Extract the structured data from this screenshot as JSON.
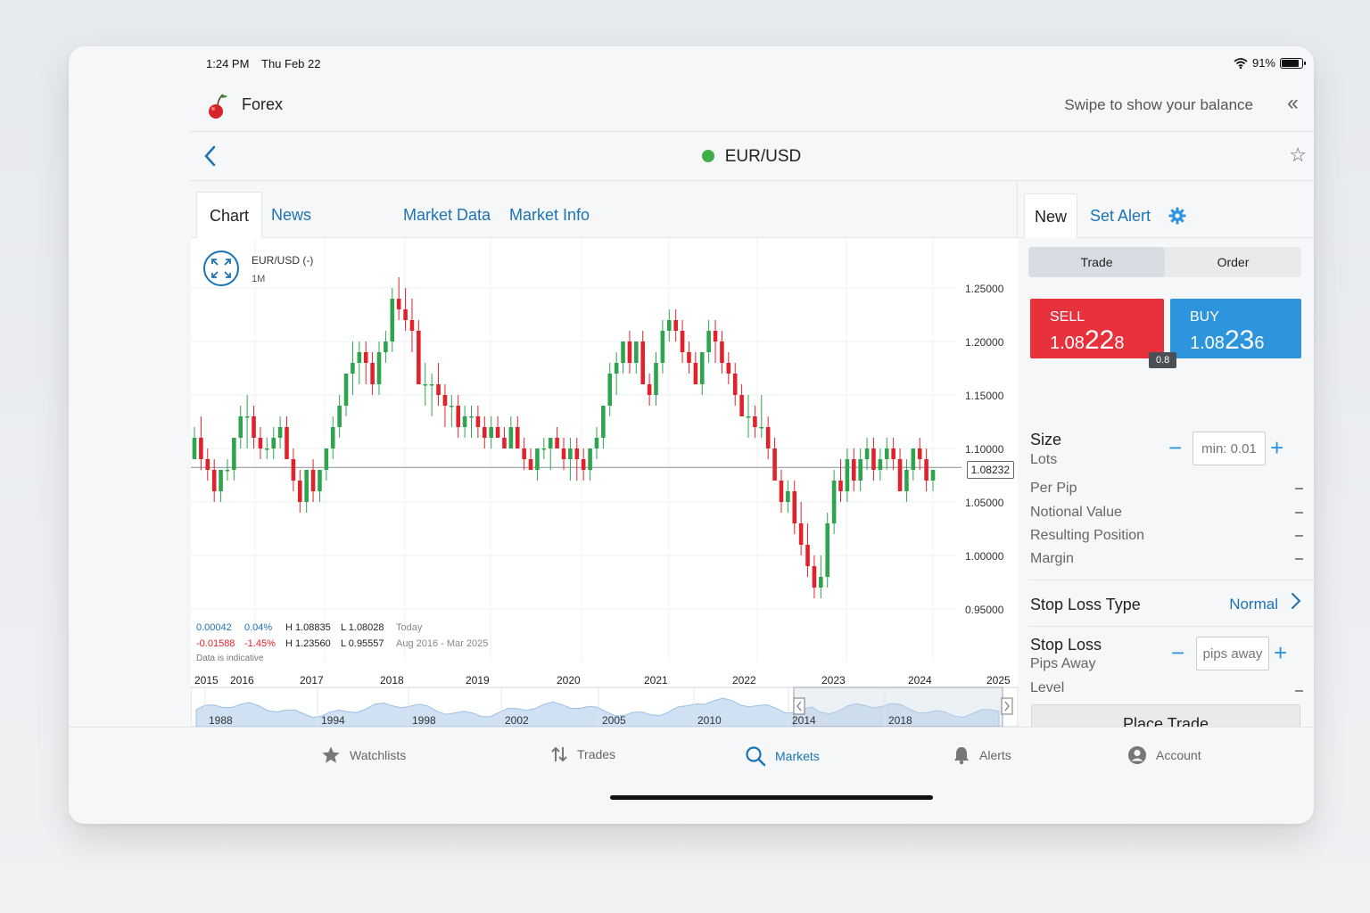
{
  "status_bar": {
    "time": "1:24 PM",
    "date": "Thu Feb 22",
    "battery": "91%",
    "battery_level": 0.91
  },
  "header": {
    "app_name": "Forex",
    "balance_hint": "Swipe to show your balance"
  },
  "instrument": {
    "symbol": "EUR/USD",
    "status_color": "#3fae49"
  },
  "tabs": [
    "Chart",
    "News",
    "Market Data",
    "Market Info"
  ],
  "chart": {
    "label": "EUR/USD (-)",
    "interval": "1M",
    "current_price": "1.08232",
    "stats": {
      "today_change": "0.00042",
      "today_pct": "0.04%",
      "today_high": "H 1.08835",
      "today_low": "L 1.08028",
      "today_label": "Today",
      "range_change": "-0.01588",
      "range_pct": "-1.45%",
      "range_high": "H 1.23560",
      "range_low": "L 0.95557",
      "range_label": "Aug 2016 - Mar 2025"
    },
    "disclaimer": "Data is indicative",
    "navigator_years": [
      "1988",
      "1994",
      "1998",
      "2002",
      "2005",
      "2010",
      "2014",
      "2018"
    ]
  },
  "chart_data": {
    "type": "candlestick",
    "symbol": "EUR/USD",
    "interval": "1M",
    "x_tick_labels": [
      "2015",
      "2016",
      "2017",
      "2018",
      "2019",
      "2020",
      "2021",
      "2022",
      "2023",
      "2024",
      "2025"
    ],
    "y_tick_labels": [
      "1.25000",
      "1.20000",
      "1.15000",
      "1.10000",
      "1.05000",
      "1.00000",
      "0.95000"
    ],
    "ylim": [
      0.92,
      1.28
    ],
    "last_price": 1.08232,
    "up_color": "#2ea44f",
    "down_color": "#e1222b",
    "candles": [
      [
        1.09,
        1.12,
        1.09,
        1.11
      ],
      [
        1.11,
        1.13,
        1.08,
        1.09
      ],
      [
        1.09,
        1.1,
        1.07,
        1.08
      ],
      [
        1.08,
        1.09,
        1.05,
        1.06
      ],
      [
        1.06,
        1.08,
        1.05,
        1.08
      ],
      [
        1.08,
        1.09,
        1.07,
        1.08
      ],
      [
        1.08,
        1.11,
        1.07,
        1.11
      ],
      [
        1.11,
        1.14,
        1.1,
        1.13
      ],
      [
        1.13,
        1.15,
        1.1,
        1.13
      ],
      [
        1.13,
        1.14,
        1.1,
        1.11
      ],
      [
        1.11,
        1.12,
        1.09,
        1.1
      ],
      [
        1.1,
        1.11,
        1.09,
        1.1
      ],
      [
        1.1,
        1.12,
        1.09,
        1.11
      ],
      [
        1.11,
        1.13,
        1.1,
        1.12
      ],
      [
        1.12,
        1.13,
        1.09,
        1.09
      ],
      [
        1.09,
        1.1,
        1.06,
        1.07
      ],
      [
        1.07,
        1.08,
        1.04,
        1.05
      ],
      [
        1.05,
        1.08,
        1.04,
        1.08
      ],
      [
        1.08,
        1.09,
        1.05,
        1.06
      ],
      [
        1.06,
        1.08,
        1.05,
        1.08
      ],
      [
        1.08,
        1.1,
        1.07,
        1.1
      ],
      [
        1.1,
        1.13,
        1.09,
        1.12
      ],
      [
        1.12,
        1.15,
        1.11,
        1.14
      ],
      [
        1.14,
        1.17,
        1.13,
        1.17
      ],
      [
        1.17,
        1.2,
        1.15,
        1.18
      ],
      [
        1.18,
        1.2,
        1.16,
        1.19
      ],
      [
        1.19,
        1.2,
        1.16,
        1.18
      ],
      [
        1.18,
        1.19,
        1.15,
        1.16
      ],
      [
        1.16,
        1.2,
        1.15,
        1.19
      ],
      [
        1.19,
        1.21,
        1.18,
        1.2
      ],
      [
        1.2,
        1.25,
        1.19,
        1.24
      ],
      [
        1.24,
        1.26,
        1.22,
        1.23
      ],
      [
        1.23,
        1.25,
        1.21,
        1.22
      ],
      [
        1.22,
        1.24,
        1.19,
        1.21
      ],
      [
        1.21,
        1.22,
        1.16,
        1.16
      ],
      [
        1.16,
        1.18,
        1.14,
        1.16
      ],
      [
        1.16,
        1.17,
        1.13,
        1.16
      ],
      [
        1.16,
        1.18,
        1.14,
        1.15
      ],
      [
        1.15,
        1.16,
        1.12,
        1.14
      ],
      [
        1.14,
        1.15,
        1.12,
        1.14
      ],
      [
        1.14,
        1.15,
        1.11,
        1.12
      ],
      [
        1.12,
        1.14,
        1.11,
        1.13
      ],
      [
        1.13,
        1.14,
        1.11,
        1.13
      ],
      [
        1.13,
        1.14,
        1.11,
        1.12
      ],
      [
        1.12,
        1.13,
        1.1,
        1.11
      ],
      [
        1.11,
        1.13,
        1.1,
        1.12
      ],
      [
        1.12,
        1.13,
        1.11,
        1.11
      ],
      [
        1.11,
        1.12,
        1.1,
        1.1
      ],
      [
        1.1,
        1.13,
        1.1,
        1.12
      ],
      [
        1.12,
        1.13,
        1.1,
        1.1
      ],
      [
        1.1,
        1.11,
        1.08,
        1.09
      ],
      [
        1.09,
        1.1,
        1.08,
        1.08
      ],
      [
        1.08,
        1.1,
        1.07,
        1.1
      ],
      [
        1.1,
        1.11,
        1.09,
        1.1
      ],
      [
        1.1,
        1.11,
        1.08,
        1.11
      ],
      [
        1.11,
        1.12,
        1.1,
        1.1
      ],
      [
        1.1,
        1.11,
        1.08,
        1.09
      ],
      [
        1.09,
        1.11,
        1.07,
        1.1
      ],
      [
        1.1,
        1.11,
        1.07,
        1.09
      ],
      [
        1.09,
        1.1,
        1.07,
        1.08
      ],
      [
        1.08,
        1.1,
        1.07,
        1.1
      ],
      [
        1.1,
        1.12,
        1.09,
        1.11
      ],
      [
        1.11,
        1.14,
        1.1,
        1.14
      ],
      [
        1.14,
        1.18,
        1.13,
        1.17
      ],
      [
        1.17,
        1.19,
        1.15,
        1.18
      ],
      [
        1.18,
        1.2,
        1.17,
        1.2
      ],
      [
        1.2,
        1.21,
        1.17,
        1.18
      ],
      [
        1.18,
        1.2,
        1.17,
        1.2
      ],
      [
        1.2,
        1.21,
        1.16,
        1.16
      ],
      [
        1.16,
        1.17,
        1.14,
        1.15
      ],
      [
        1.15,
        1.19,
        1.14,
        1.18
      ],
      [
        1.18,
        1.22,
        1.17,
        1.21
      ],
      [
        1.21,
        1.23,
        1.2,
        1.22
      ],
      [
        1.22,
        1.23,
        1.2,
        1.21
      ],
      [
        1.21,
        1.22,
        1.18,
        1.19
      ],
      [
        1.19,
        1.2,
        1.17,
        1.18
      ],
      [
        1.18,
        1.19,
        1.16,
        1.16
      ],
      [
        1.16,
        1.19,
        1.15,
        1.19
      ],
      [
        1.19,
        1.22,
        1.18,
        1.21
      ],
      [
        1.21,
        1.22,
        1.18,
        1.2
      ],
      [
        1.2,
        1.21,
        1.17,
        1.18
      ],
      [
        1.18,
        1.19,
        1.16,
        1.17
      ],
      [
        1.17,
        1.18,
        1.14,
        1.15
      ],
      [
        1.15,
        1.16,
        1.13,
        1.13
      ],
      [
        1.13,
        1.15,
        1.11,
        1.13
      ],
      [
        1.13,
        1.14,
        1.11,
        1.12
      ],
      [
        1.12,
        1.15,
        1.11,
        1.12
      ],
      [
        1.12,
        1.13,
        1.09,
        1.1
      ],
      [
        1.1,
        1.11,
        1.07,
        1.07
      ],
      [
        1.07,
        1.08,
        1.04,
        1.05
      ],
      [
        1.05,
        1.07,
        1.04,
        1.06
      ],
      [
        1.06,
        1.07,
        1.02,
        1.03
      ],
      [
        1.03,
        1.05,
        1.0,
        1.01
      ],
      [
        1.01,
        1.03,
        0.98,
        0.99
      ],
      [
        0.99,
        1.0,
        0.96,
        0.97
      ],
      [
        0.97,
        1.0,
        0.96,
        0.98
      ],
      [
        0.98,
        1.04,
        0.97,
        1.03
      ],
      [
        1.03,
        1.08,
        1.02,
        1.07
      ],
      [
        1.07,
        1.09,
        1.05,
        1.06
      ],
      [
        1.06,
        1.1,
        1.05,
        1.09
      ],
      [
        1.09,
        1.1,
        1.06,
        1.07
      ],
      [
        1.07,
        1.1,
        1.06,
        1.09
      ],
      [
        1.09,
        1.11,
        1.08,
        1.1
      ],
      [
        1.1,
        1.11,
        1.07,
        1.08
      ],
      [
        1.08,
        1.1,
        1.07,
        1.09
      ],
      [
        1.09,
        1.11,
        1.08,
        1.1
      ],
      [
        1.1,
        1.11,
        1.08,
        1.09
      ],
      [
        1.09,
        1.1,
        1.06,
        1.06
      ],
      [
        1.06,
        1.09,
        1.05,
        1.08
      ],
      [
        1.08,
        1.1,
        1.07,
        1.1
      ],
      [
        1.1,
        1.11,
        1.08,
        1.09
      ],
      [
        1.09,
        1.1,
        1.06,
        1.07
      ],
      [
        1.07,
        1.08,
        1.06,
        1.08
      ]
    ]
  },
  "order_tabs": {
    "new": "New",
    "set_alert": "Set Alert"
  },
  "segment": [
    "Trade",
    "Order"
  ],
  "sell": {
    "label": "SELL",
    "price_pre": "1.08",
    "price_big": "22",
    "price_post": "8"
  },
  "buy": {
    "label": "BUY",
    "price_pre": "1.08",
    "price_big": "23",
    "price_post": "6"
  },
  "spread": "0.8",
  "size": {
    "title": "Size",
    "unit": "Lots",
    "placeholder": "min: 0.01"
  },
  "info_rows": [
    "Per Pip",
    "Notional Value",
    "Resulting Position",
    "Margin"
  ],
  "dash": "–",
  "stop_loss_type": {
    "title": "Stop Loss Type",
    "value": "Normal"
  },
  "stop_loss": {
    "title": "Stop Loss",
    "sub": "Pips Away",
    "placeholder": "pips away",
    "level": "Level"
  },
  "place_trade": "Place Trade",
  "bottom_nav": [
    "Watchlists",
    "Trades",
    "Markets",
    "Alerts",
    "Account"
  ]
}
